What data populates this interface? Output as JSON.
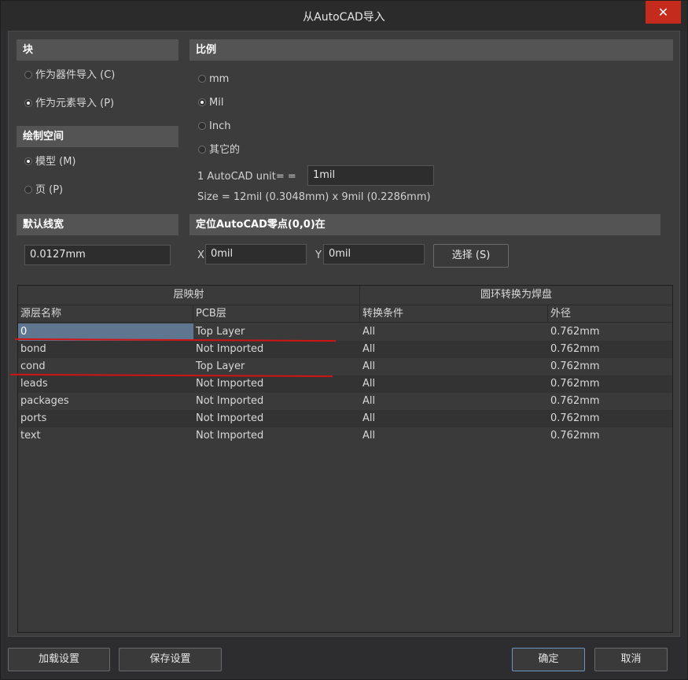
{
  "window": {
    "title": "从AutoCAD导入",
    "close_glyph": "✕"
  },
  "blocks": {
    "header": "块",
    "option_component": "作为器件导入 (C)",
    "option_primitive": "作为元素导入 (P)",
    "selected": "option_primitive"
  },
  "drawing_space": {
    "header": "绘制空间",
    "option_model": "模型 (M)",
    "option_page": "页 (P)",
    "selected": "option_model"
  },
  "default_width": {
    "header": "默认线宽",
    "value": "0.0127mm"
  },
  "scale": {
    "header": "比例",
    "options": [
      "mm",
      "Mil",
      "Inch",
      "其它的"
    ],
    "selected": "Mil",
    "unit_label": "1 AutoCAD unit= =",
    "unit_value": "1mil",
    "size_text": "Size = 12mil (0.3048mm) x 9mil (0.2286mm)"
  },
  "origin": {
    "header": "定位AutoCAD零点(0,0)在",
    "x_label": "X",
    "x_value": "0mil",
    "y_label": "Y",
    "y_value": "0mil",
    "select_button": "选择 (S)"
  },
  "table": {
    "group_layer_map": "层映射",
    "group_ring_convert": "圆环转换为焊盘",
    "columns": [
      "源层名称",
      "PCB层",
      "转换条件",
      "外径"
    ],
    "rows": [
      {
        "source": "0",
        "pcb": "Top Layer",
        "condition": "All",
        "diameter": "0.762mm"
      },
      {
        "source": "bond",
        "pcb": "Not Imported",
        "condition": "All",
        "diameter": "0.762mm"
      },
      {
        "source": "cond",
        "pcb": "Top Layer",
        "condition": "All",
        "diameter": "0.762mm"
      },
      {
        "source": "leads",
        "pcb": "Not Imported",
        "condition": "All",
        "diameter": "0.762mm"
      },
      {
        "source": "packages",
        "pcb": "Not Imported",
        "condition": "All",
        "diameter": "0.762mm"
      },
      {
        "source": "ports",
        "pcb": "Not Imported",
        "condition": "All",
        "diameter": "0.762mm"
      },
      {
        "source": "text",
        "pcb": "Not Imported",
        "condition": "All",
        "diameter": "0.762mm"
      }
    ],
    "selected_row": 0,
    "underlined_rows": [
      0,
      2
    ]
  },
  "footer": {
    "load_settings": "加载设置",
    "save_settings": "保存设置",
    "ok": "确定",
    "cancel": "取消"
  },
  "colors": {
    "selection": "#5f7691",
    "annotation_red": "#d01414",
    "close_button": "#c42b1c"
  }
}
